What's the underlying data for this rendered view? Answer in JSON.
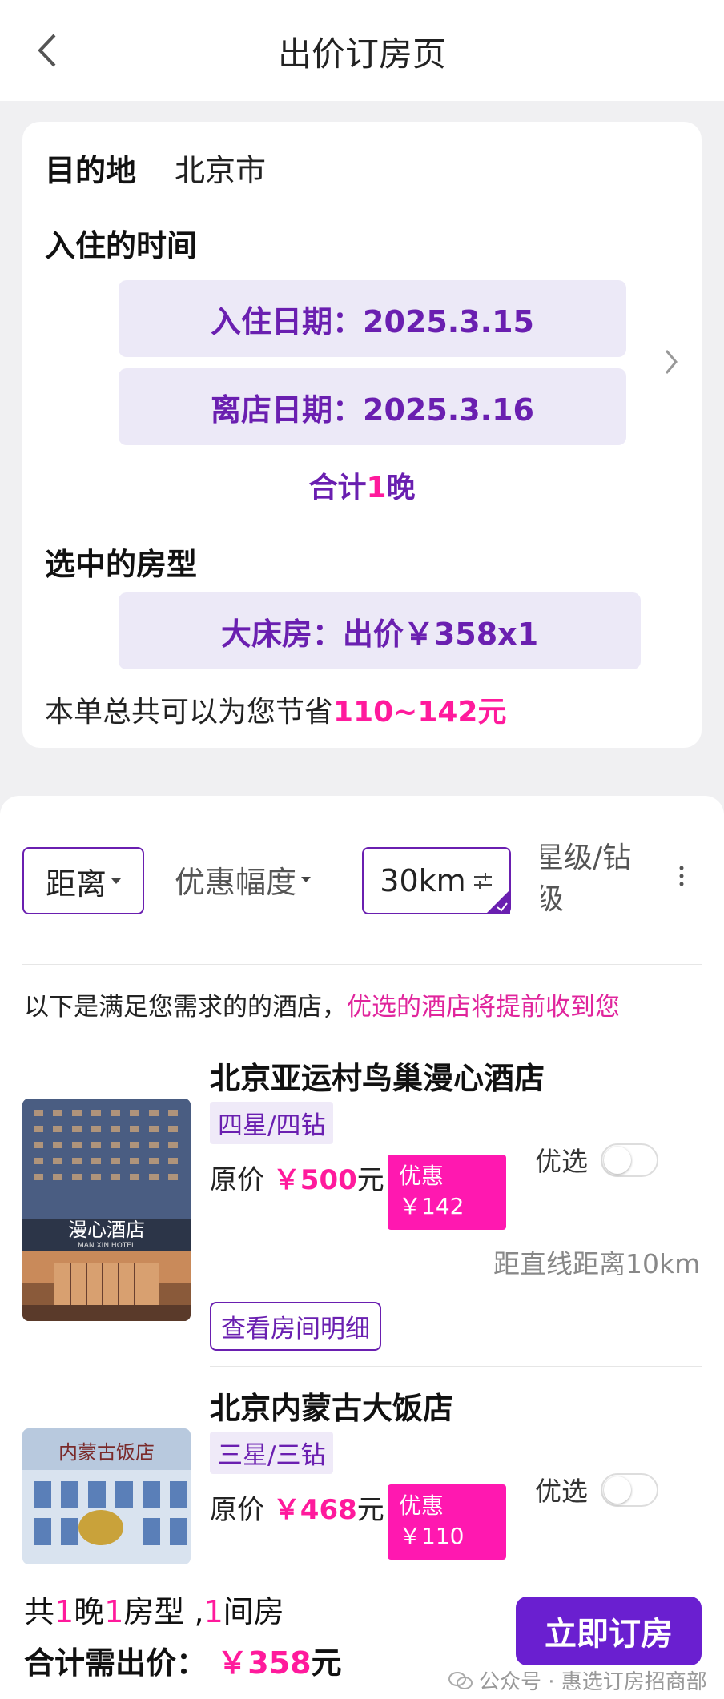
{
  "header": {
    "title": "出价订房页"
  },
  "booking": {
    "destination_label": "目的地",
    "destination_value": "北京市",
    "time_label": "入住的时间",
    "checkin": "入住日期：2025.3.15",
    "checkout": "离店日期：2025.3.16",
    "nights_prefix": "合计",
    "nights_num": "1",
    "nights_suffix": "晚",
    "room_label": "选中的房型",
    "room_value": "大床房：出价￥358x1",
    "saving_prefix": "本单总共可以为您节省",
    "saving_value": "110~142元"
  },
  "filters": {
    "distance": "距离",
    "discount": "优惠幅度",
    "range": "30km",
    "star_line1": "星级/钻",
    "star_line2": "级"
  },
  "intro": {
    "text": "以下是满足您需求的的酒店，",
    "highlight": "优选的酒店将提前收到您"
  },
  "hotels": [
    {
      "name": "北京亚运村鸟巢漫心酒店",
      "stars": "四星/四钻",
      "price_prefix": "原价",
      "price": "￥500",
      "price_suffix": "元",
      "discount_label": "优惠",
      "discount_value": "￥142",
      "pick_label": "优选",
      "distance": "距直线距离10km",
      "detail": "查看房间明细",
      "photo_sign": "漫心酒店",
      "photo_sub": "MAN XIN HOTEL"
    },
    {
      "name": "北京内蒙古大饭店",
      "stars": "三星/三钻",
      "price_prefix": "原价",
      "price": "￥468",
      "price_suffix": "元",
      "discount_label": "优惠",
      "discount_value": "￥110",
      "pick_label": "优选",
      "photo_sign": "内蒙古饭店"
    }
  ],
  "footer": {
    "summary_a": "共",
    "summary_n1": "1",
    "summary_b": "晚",
    "summary_n2": "1",
    "summary_c": "房型 ,",
    "summary_n3": "1",
    "summary_d": "间房",
    "total_label": "合计需出价：",
    "total_value": "￥358",
    "total_unit": "元",
    "book_button": "立即订房",
    "watermark": "公众号 · 惠选订房招商部"
  },
  "colors": {
    "accent": "#6a1fb0",
    "pink": "#ff1a9c",
    "button": "#6a1fd0",
    "pill_bg": "#ece9f7"
  }
}
